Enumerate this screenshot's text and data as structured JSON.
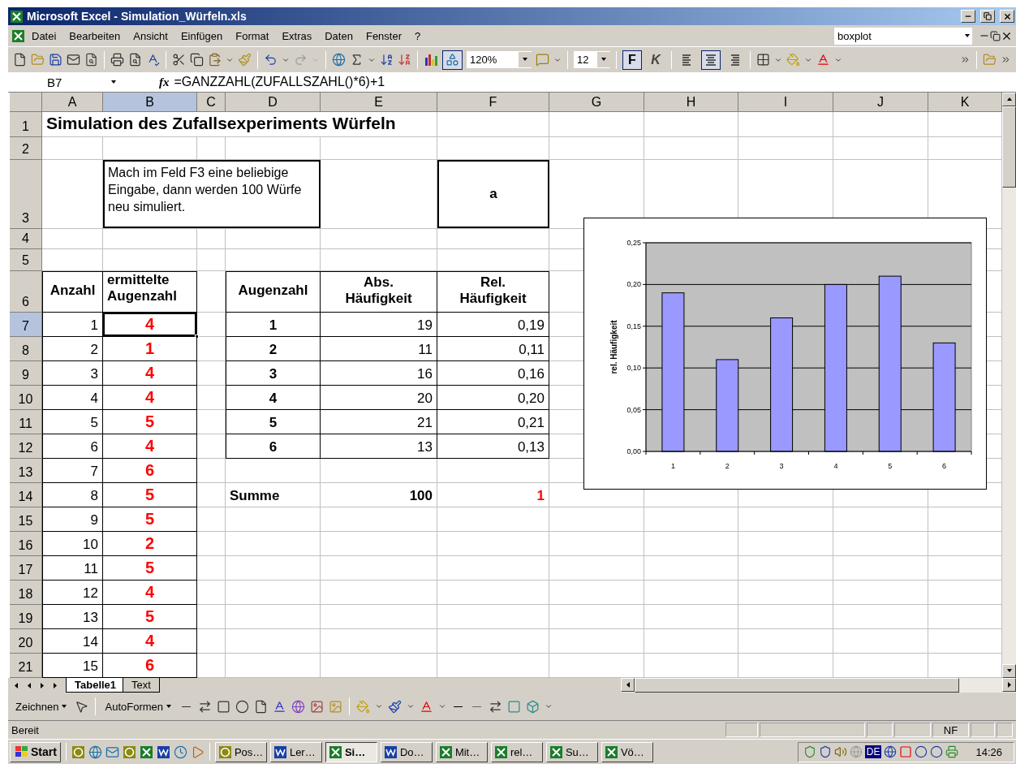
{
  "window": {
    "title": "Microsoft Excel - Simulation_Würfeln.xls"
  },
  "menu": [
    "Datei",
    "Bearbeiten",
    "Ansicht",
    "Einfügen",
    "Format",
    "Extras",
    "Daten",
    "Fenster",
    "?"
  ],
  "help_search": {
    "value": "boxplot"
  },
  "toolbar": {
    "drawing_toggle": {
      "pressed": true
    },
    "zoom": "120%",
    "font_size": "12",
    "bold": {
      "label": "F",
      "pressed": true
    },
    "italic": {
      "label": "K",
      "pressed": false
    },
    "align": [
      {
        "pressed": false
      },
      {
        "pressed": true
      },
      {
        "pressed": false
      }
    ]
  },
  "formula_bar": {
    "name_box": "B7",
    "function_button": "fx",
    "formula": "=GANZZAHL(ZUFALLSZAHL()*6)+1"
  },
  "sheet": {
    "columns": [
      {
        "label": "A",
        "selected": false
      },
      {
        "label": "B",
        "selected": true
      },
      {
        "label": "C",
        "selected": false
      },
      {
        "label": "D",
        "selected": false
      },
      {
        "label": "E",
        "selected": false
      },
      {
        "label": "F",
        "selected": false
      },
      {
        "label": "G",
        "selected": false
      },
      {
        "label": "H",
        "selected": false
      },
      {
        "label": "I",
        "selected": false
      },
      {
        "label": "J",
        "selected": false
      },
      {
        "label": "K",
        "selected": false
      }
    ],
    "rows": [
      {
        "label": "1",
        "selected": false
      },
      {
        "label": "2",
        "selected": false
      },
      {
        "label": "3",
        "selected": false
      },
      {
        "label": "4",
        "selected": false
      },
      {
        "label": "5",
        "selected": false
      },
      {
        "label": "6",
        "selected": false
      },
      {
        "label": "7",
        "selected": true
      },
      {
        "label": "8",
        "selected": false
      },
      {
        "label": "9",
        "selected": false
      },
      {
        "label": "10",
        "selected": false
      },
      {
        "label": "11",
        "selected": false
      },
      {
        "label": "12",
        "selected": false
      },
      {
        "label": "13",
        "selected": false
      },
      {
        "label": "14",
        "selected": false
      },
      {
        "label": "15",
        "selected": false
      },
      {
        "label": "16",
        "selected": false
      },
      {
        "label": "17",
        "selected": false
      },
      {
        "label": "18",
        "selected": false
      },
      {
        "label": "19",
        "selected": false
      },
      {
        "label": "20",
        "selected": false
      },
      {
        "label": "21",
        "selected": false
      }
    ],
    "title": "Simulation des Zufallsexperiments Würfeln",
    "instruction": "Mach im Feld F3 eine beliebige Eingabe, dann werden 100 Würfe neu simuliert.",
    "input_cell": "a",
    "throws": {
      "headers": [
        "Anzahl",
        "ermittelte Augenzahl"
      ],
      "rows": [
        {
          "n": "1",
          "value": "4"
        },
        {
          "n": "2",
          "value": "1"
        },
        {
          "n": "3",
          "value": "4"
        },
        {
          "n": "4",
          "value": "4"
        },
        {
          "n": "5",
          "value": "5"
        },
        {
          "n": "6",
          "value": "4"
        },
        {
          "n": "7",
          "value": "6"
        },
        {
          "n": "8",
          "value": "5"
        },
        {
          "n": "9",
          "value": "5"
        },
        {
          "n": "10",
          "value": "2"
        },
        {
          "n": "11",
          "value": "5"
        },
        {
          "n": "12",
          "value": "4"
        },
        {
          "n": "13",
          "value": "5"
        },
        {
          "n": "14",
          "value": "4"
        },
        {
          "n": "15",
          "value": "6"
        }
      ]
    },
    "frequencies": {
      "headers": [
        "Augenzahl",
        "Abs. Häufigkeit",
        "Rel. Häufigkeit"
      ],
      "rows": [
        [
          "1",
          "19",
          "0,19"
        ],
        [
          "2",
          "11",
          "0,11"
        ],
        [
          "3",
          "16",
          "0,16"
        ],
        [
          "4",
          "20",
          "0,20"
        ],
        [
          "5",
          "21",
          "0,21"
        ],
        [
          "6",
          "13",
          "0,13"
        ]
      ],
      "total": [
        "Summe",
        "100",
        "1"
      ]
    },
    "chart": {
      "chart_data": {
        "type": "bar",
        "grid": true,
        "ylabel": "rel. Häufigkeit",
        "categories": [
          "1",
          "2",
          "3",
          "4",
          "5",
          "6"
        ],
        "series": [
          {
            "color": "#9999ff",
            "values": [
              0.19,
              0.11,
              0.16,
              0.2,
              0.21,
              0.13
            ]
          }
        ],
        "ylim": [
          0,
          0.25
        ],
        "yticks": [
          {
            "value": 0,
            "label": "0,00"
          },
          {
            "value": 0.05,
            "label": "0,05"
          },
          {
            "value": 0.1,
            "label": "0,10"
          },
          {
            "value": 0.15,
            "label": "0,15"
          },
          {
            "value": 0.2,
            "label": "0,20"
          },
          {
            "value": 0.25,
            "label": "0,25"
          }
        ]
      }
    }
  },
  "sheet_tabs": [
    {
      "label": "Tabelle1",
      "selected": true
    },
    {
      "label": "Text",
      "selected": false
    }
  ],
  "drawing_toolbar": {
    "draw_menu": "Zeichnen",
    "autoshapes_menu": "AutoFormen"
  },
  "status_bar": {
    "text": "Bereit",
    "indicator": "NF"
  },
  "taskbar": {
    "start": "Start",
    "tasks": [
      {
        "label": "Pos…",
        "kind": "clock",
        "selected": false
      },
      {
        "label": "Ler…",
        "kind": "word",
        "selected": false
      },
      {
        "label": "Si…",
        "kind": "excel",
        "selected": true
      },
      {
        "label": "Do…",
        "kind": "word",
        "selected": false
      },
      {
        "label": "Mit…",
        "kind": "excel",
        "selected": false
      },
      {
        "label": "rel…",
        "kind": "excel",
        "selected": false
      },
      {
        "label": "Su…",
        "kind": "excel",
        "selected": false
      },
      {
        "label": "Vö…",
        "kind": "excel",
        "selected": false
      }
    ],
    "tray_language": "DE",
    "clock": "14:26"
  }
}
